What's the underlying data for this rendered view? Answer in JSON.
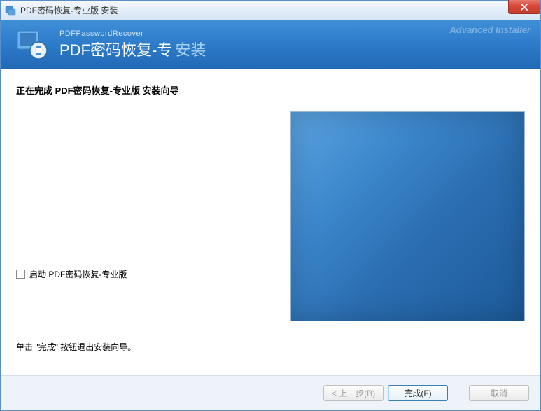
{
  "window": {
    "title": "PDF密码恢复-专业版 安装"
  },
  "banner": {
    "subtitle": "PDFPasswordRecover",
    "title_main": "PDF密码恢复-专",
    "title_suffix": "安装",
    "watermark": "Advanced Installer"
  },
  "content": {
    "heading": "正在完成 PDF密码恢复-专业版 安装向导",
    "checkbox_label": "启动 PDF密码恢复-专业版",
    "exit_hint": "单击 \"完成\" 按钮退出安装向导。"
  },
  "buttons": {
    "back": "< 上一步(B)",
    "finish": "完成(F)",
    "cancel": "取消"
  }
}
